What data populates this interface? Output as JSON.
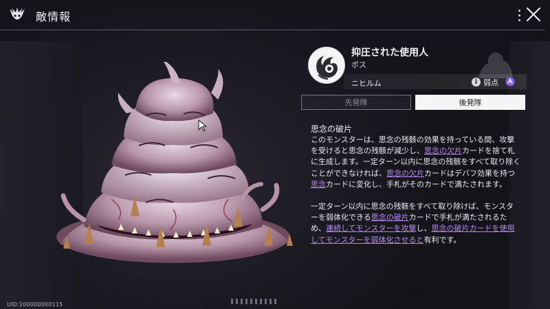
{
  "header": {
    "title": "敵情報"
  },
  "enemy": {
    "name": "抑圧された使用人",
    "rank": "ボス",
    "attribute": "ニヒルム",
    "weakness_label": "弱点",
    "info_glyph": "i"
  },
  "tabs": [
    {
      "label": "先発隊",
      "selected": false
    },
    {
      "label": "後発隊",
      "selected": true
    }
  ],
  "skill": {
    "title": "思念の破片",
    "para1": [
      {
        "t": "このモンスターは、思念の残骸の効果を持っている間、攻撃を受けると思念の残骸が減少し、"
      },
      {
        "t": "思念の欠片",
        "hl": true
      },
      {
        "t": "カードを捨て札に生成します。一定ターン以内に思念の残骸をすべて取り除くことができなければ、"
      },
      {
        "t": "思念の欠片",
        "hl": true
      },
      {
        "t": "カードはデバフ効果を持つ"
      },
      {
        "t": "思念",
        "hl": true
      },
      {
        "t": "カードに変化し、手札がそのカードで満たされます。"
      }
    ],
    "para2": [
      {
        "t": "一定ターン以内に思念の残骸をすべて取り除けば、モンスターを弱体化できる"
      },
      {
        "t": "思念の破片",
        "hl": true
      },
      {
        "t": "カードで手札が満たされるため、"
      },
      {
        "t": "連続してモンスターを攻撃",
        "hl": true
      },
      {
        "t": "し、"
      },
      {
        "t": "思念の破片カードを使用してモンスターを弱体化させると",
        "hl": true
      },
      {
        "t": "有利です。"
      }
    ]
  },
  "footer": {
    "uid": "UID:100000000115",
    "page_indicator_count": 10
  },
  "colors": {
    "accent_purple": "#b48cf2",
    "weak_icon": "#8a5cf0",
    "background": "#17161d"
  },
  "icons": [
    "game-emblem-icon",
    "more-icon",
    "close-icon",
    "info-icon",
    "weakness-element-icon",
    "boss-emblem-icon",
    "mouse-cursor-icon"
  ]
}
